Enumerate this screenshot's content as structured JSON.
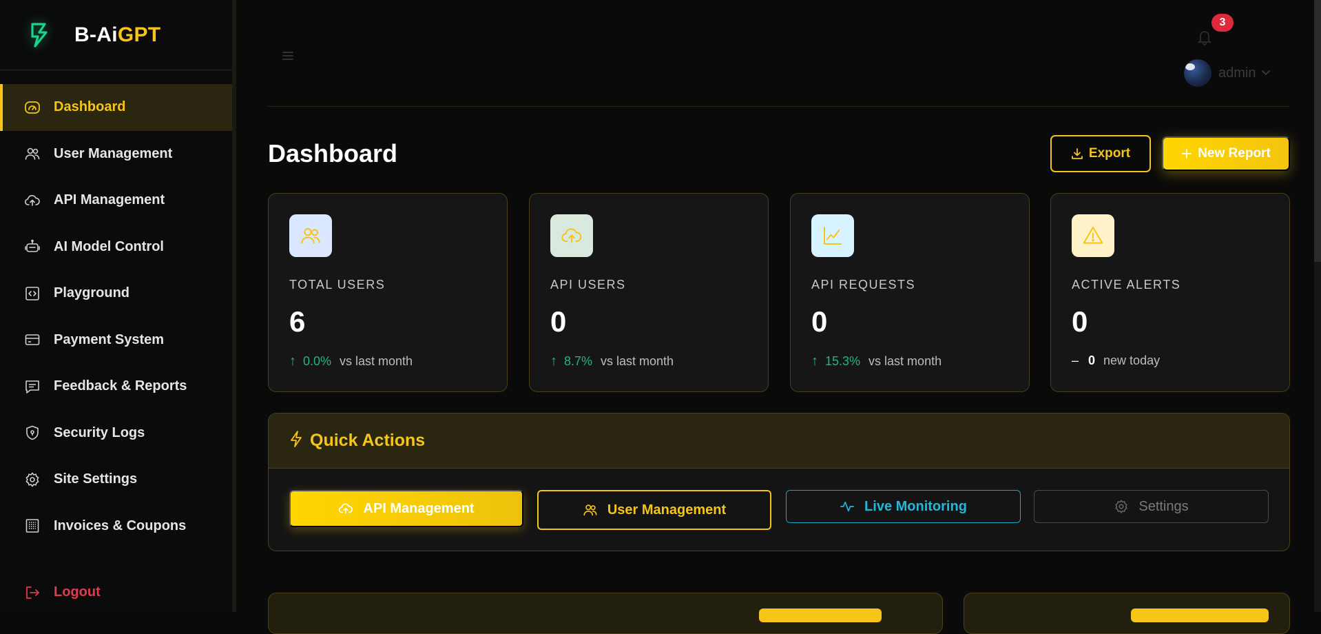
{
  "brand": {
    "name_main": "B-Ai",
    "name_accent": "GPT",
    "accent_color": "#f5c518",
    "logo_icon": "brand-b-icon"
  },
  "sidebar": {
    "items": [
      {
        "label": "Dashboard",
        "icon": "dashboard-gauge-icon",
        "active": true
      },
      {
        "label": "User Management",
        "icon": "users-icon"
      },
      {
        "label": "API Management",
        "icon": "cloud-upload-icon"
      },
      {
        "label": "AI Model Control",
        "icon": "robot-icon"
      },
      {
        "label": "Playground",
        "icon": "code-brackets-icon"
      },
      {
        "label": "Payment System",
        "icon": "credit-card-icon"
      },
      {
        "label": "Feedback & Reports",
        "icon": "message-icon"
      },
      {
        "label": "Security Logs",
        "icon": "shield-icon"
      },
      {
        "label": "Site Settings",
        "icon": "gear-icon"
      },
      {
        "label": "Invoices & Coupons",
        "icon": "receipt-icon"
      }
    ],
    "logout": {
      "label": "Logout",
      "icon": "logout-icon",
      "color": "#e03b4e"
    }
  },
  "topbar": {
    "notifications_count": "3",
    "user_name": "admin"
  },
  "page": {
    "title": "Dashboard",
    "export_label": "Export",
    "new_report_label": "New Report"
  },
  "stats": [
    {
      "label": "TOTAL USERS",
      "value": "6",
      "trend_pct": "0.0%",
      "trend_text": "vs last month",
      "icon": "users-icon",
      "icon_bg": "#dbe6ff"
    },
    {
      "label": "API USERS",
      "value": "0",
      "trend_pct": "8.7%",
      "trend_text": "vs last month",
      "icon": "cloud-upload-icon",
      "icon_bg": "#d9e9dd"
    },
    {
      "label": "API REQUESTS",
      "value": "0",
      "trend_pct": "15.3%",
      "trend_text": "vs last month",
      "icon": "chart-line-icon",
      "icon_bg": "#d6f3ff"
    },
    {
      "label": "ACTIVE ALERTS",
      "value": "0",
      "trend_num": "0",
      "trend_text": "new today",
      "icon": "warning-icon",
      "icon_bg": "#fff1c8"
    }
  ],
  "quick_actions": {
    "title": "Quick Actions",
    "buttons": [
      {
        "label": "API Management",
        "icon": "cloud-upload-icon"
      },
      {
        "label": "User Management",
        "icon": "users-icon"
      },
      {
        "label": "Live Monitoring",
        "icon": "activity-icon"
      },
      {
        "label": "Settings",
        "icon": "gear-icon"
      }
    ]
  },
  "colors": {
    "accent": "#f5c518",
    "positive": "#23b57a",
    "danger": "#e03b4e",
    "info": "#22b8dc"
  }
}
